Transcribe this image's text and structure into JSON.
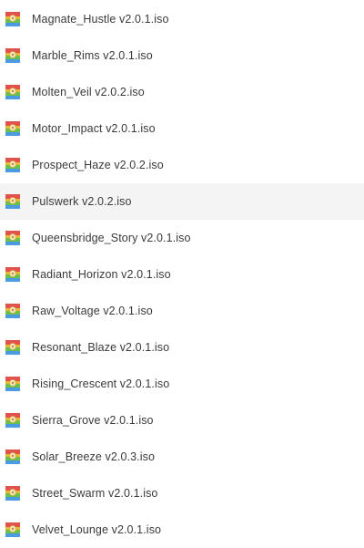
{
  "files": [
    {
      "name": "Magnate_Hustle v2.0.1.iso",
      "icon": "disk-image-icon",
      "selected": false
    },
    {
      "name": "Marble_Rims v2.0.1.iso",
      "icon": "disk-image-icon",
      "selected": false
    },
    {
      "name": "Molten_Veil v2.0.2.iso",
      "icon": "disk-image-icon",
      "selected": false
    },
    {
      "name": "Motor_Impact v2.0.1.iso",
      "icon": "disk-image-icon",
      "selected": false
    },
    {
      "name": "Prospect_Haze v2.0.2.iso",
      "icon": "disk-image-icon",
      "selected": false
    },
    {
      "name": "Pulswerk v2.0.2.iso",
      "icon": "disk-image-icon",
      "selected": true
    },
    {
      "name": "Queensbridge_Story v2.0.1.iso",
      "icon": "disk-image-icon",
      "selected": false
    },
    {
      "name": "Radiant_Horizon v2.0.1.iso",
      "icon": "disk-image-icon",
      "selected": false
    },
    {
      "name": "Raw_Voltage v2.0.1.iso",
      "icon": "disk-image-icon",
      "selected": false
    },
    {
      "name": "Resonant_Blaze v2.0.1.iso",
      "icon": "disk-image-icon",
      "selected": false
    },
    {
      "name": "Rising_Crescent v2.0.1.iso",
      "icon": "disk-image-icon",
      "selected": false
    },
    {
      "name": "Sierra_Grove v2.0.1.iso",
      "icon": "disk-image-icon",
      "selected": false
    },
    {
      "name": "Solar_Breeze v2.0.3.iso",
      "icon": "disk-image-icon",
      "selected": false
    },
    {
      "name": "Street_Swarm v2.0.1.iso",
      "icon": "disk-image-icon",
      "selected": false
    },
    {
      "name": "Velvet_Lounge v2.0.1.iso",
      "icon": "disk-image-icon",
      "selected": false
    }
  ],
  "colors": {
    "selected_row": "#f4f4f4",
    "text": "#3a3a3a",
    "icon_top": "#e0524b",
    "icon_middle": "#e8b92e",
    "icon_bottom": "#4c9be0",
    "icon_band": "#6cc04a"
  }
}
